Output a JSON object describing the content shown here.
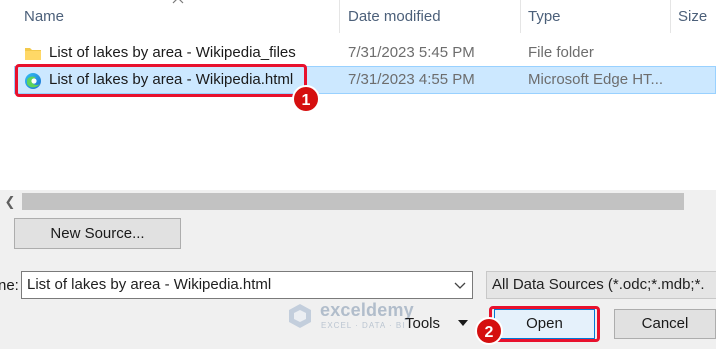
{
  "columns": {
    "name": "Name",
    "date_modified": "Date modified",
    "type": "Type",
    "size": "Size"
  },
  "files": [
    {
      "name": "List of lakes by area - Wikipedia_files",
      "date": "7/31/2023 5:45 PM",
      "type": "File folder",
      "icon": "folder-icon",
      "selected": false
    },
    {
      "name": "List of lakes by area - Wikipedia.html",
      "date": "7/31/2023 4:55 PM",
      "type": "Microsoft Edge HT...",
      "icon": "edge-icon",
      "selected": true
    }
  ],
  "step_markers": {
    "first": "1",
    "second": "2"
  },
  "buttons": {
    "new_source": "New Source...",
    "tools": "Tools",
    "open": "Open",
    "cancel": "Cancel"
  },
  "file_name": {
    "label": "ne:",
    "value": "List of lakes by area - Wikipedia.html"
  },
  "file_type_filter": {
    "selected": "All Data Sources (*.odc;*.mdb;*."
  },
  "watermark": {
    "title": "exceldemy",
    "subtitle": "EXCEL · DATA · BI"
  },
  "colors": {
    "selection": "#cce8ff",
    "annotation_red": "#e8112d",
    "marker_red": "#d50f0f"
  }
}
